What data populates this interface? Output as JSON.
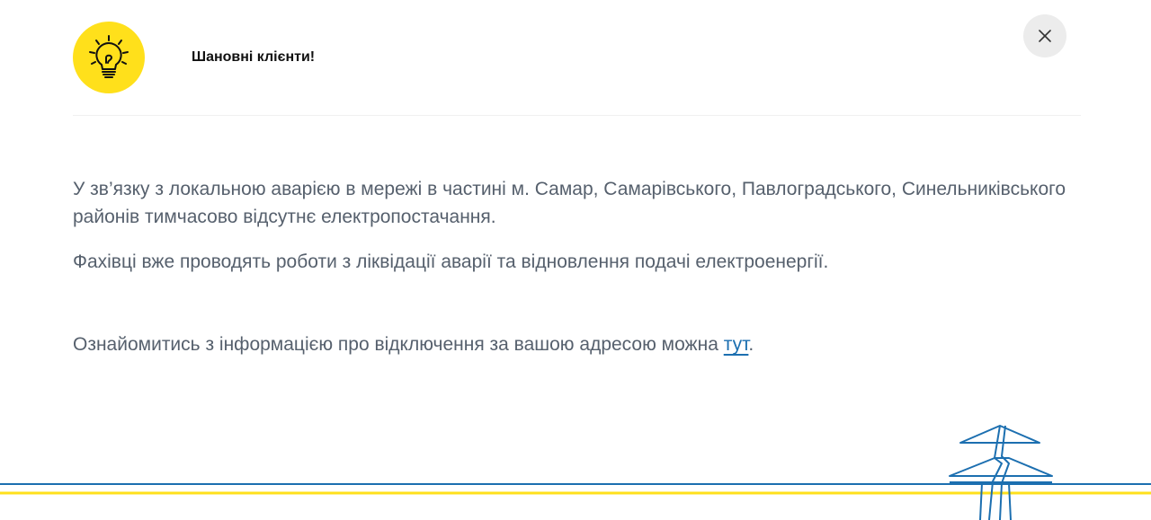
{
  "modal": {
    "title": "Шановні клієнти!",
    "icon": "lightbulb-icon",
    "close_icon": "close-icon"
  },
  "message": {
    "paragraph1": "У зв’язку з локальною аварією в мережі в частині м. Самар, Самарівського, Павлоградського, Синельниківського районів тимчасово відсутнє електропостачання.",
    "paragraph2": "Фахівці вже проводять роботи з ліквідації аварії та відновлення подачі електроенергії.",
    "paragraph3_prefix": "Ознайомитись з інформацією про відключення за вашою адресою можна ",
    "link_text": "тут",
    "paragraph3_suffix": "."
  },
  "colors": {
    "accent_yellow": "#ffe01b",
    "line_blue": "#1c6fb0",
    "text_gray": "#56606d",
    "link_blue": "#1c6fb0"
  },
  "decoration": {
    "footer_icon": "power-line-tower-icon"
  }
}
